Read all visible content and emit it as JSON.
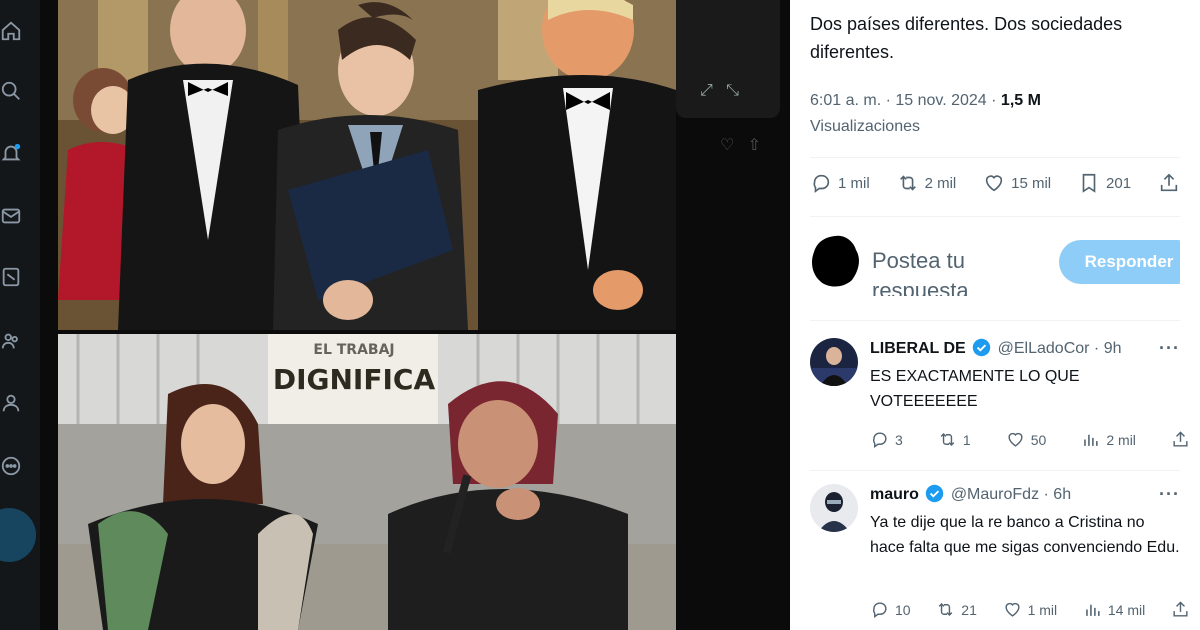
{
  "tweet": {
    "text": "Dos países diferentes. Dos sociedades diferentes.",
    "time": "6:01 a. m. · 15 nov. 2024 · ",
    "views_count": "1,5 M",
    "views_label": "Visualizaciones",
    "stats": {
      "replies": "1 mil",
      "reposts": "2 mil",
      "likes": "15 mil",
      "bookmarks": "201"
    }
  },
  "compose": {
    "placeholder": "Postea tu respuesta",
    "button": "Responder"
  },
  "photo": {
    "sign_line1": "EL TRABAJ",
    "sign_line2": "DIGNIFICA"
  },
  "replies": [
    {
      "name": "LIBERAL DE",
      "handle": "@ElLadoCor",
      "time": "· 9h",
      "text": "ES EXACTAMENTE LO QUE VOTEEEEEEE",
      "replies": "3",
      "reposts": "1",
      "likes": "50",
      "views": "2 mil"
    },
    {
      "name": "mauro",
      "handle": "@MauroFdz",
      "time": "· 6h",
      "text": "Ya te dije que la re banco a Cristina no hace falta que me sigas convenciendo Edu.",
      "replies": "10",
      "reposts": "21",
      "likes": "1 mil",
      "views": "14 mil"
    }
  ],
  "icons": [
    "home-icon",
    "search-icon",
    "notifications-icon",
    "messages-icon",
    "lists-icon",
    "communities-icon",
    "profile-icon",
    "more-icon",
    "reply-icon",
    "repost-icon",
    "like-icon",
    "bookmark-icon",
    "share-icon",
    "views-icon",
    "verified-icon",
    "expand-icon"
  ],
  "colors": {
    "accent": "#1d9bf0",
    "button_disabled": "#8ecdf7",
    "secondary_text": "#536471"
  }
}
